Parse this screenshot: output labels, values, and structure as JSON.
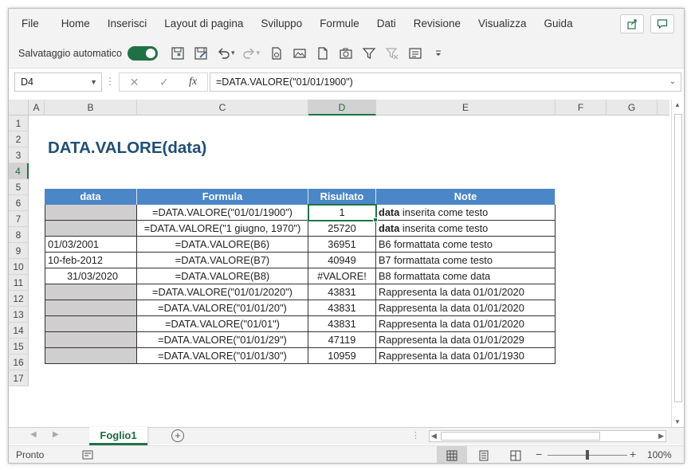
{
  "menu": [
    "File",
    "Home",
    "Inserisci",
    "Layout di pagina",
    "Sviluppo",
    "Formule",
    "Dati",
    "Revisione",
    "Visualizza",
    "Guida"
  ],
  "menu_right_icons": [
    "share-icon",
    "comment-icon"
  ],
  "toolbar": {
    "autosave_label": "Salvataggio automatico",
    "autosave_on": true,
    "icons": [
      "save-icon",
      "save-as-icon",
      "undo-icon",
      "redo-icon",
      "document-icon",
      "image-edit-icon",
      "new-document-icon",
      "camera-icon",
      "filter-icon",
      "clear-filter-icon",
      "form-icon",
      "customize-toolbar-icon"
    ]
  },
  "formula_bar": {
    "name_box": "D4",
    "formula": "=DATA.VALORE(\"01/01/1900\")"
  },
  "columns": [
    "A",
    "B",
    "C",
    "D",
    "E",
    "F",
    "G"
  ],
  "selected_column": "D",
  "rows": [
    "1",
    "2",
    "3",
    "4",
    "5",
    "6",
    "7",
    "8",
    "9",
    "10",
    "11",
    "12",
    "13",
    "14",
    "15",
    "16",
    "17"
  ],
  "selected_row": "4",
  "sheet_title": "DATA.VALORE(data)",
  "table": {
    "headers": [
      "data",
      "Formula",
      "Risultato",
      "Note"
    ],
    "rows": [
      {
        "data": "",
        "formula": "=DATA.VALORE(\"01/01/1900\")",
        "risultato": "1",
        "note_bold": "data",
        "note": " inserita come testo"
      },
      {
        "data": "",
        "formula": "=DATA.VALORE(\"1 giugno, 1970\")",
        "risultato": "25720",
        "note_bold": "data",
        "note": " inserita come testo"
      },
      {
        "data": "01/03/2001",
        "formula": "=DATA.VALORE(B6)",
        "risultato": "36951",
        "note_bold": "",
        "note": "B6 formattata come testo"
      },
      {
        "data": "10-feb-2012",
        "formula": "=DATA.VALORE(B7)",
        "risultato": "40949",
        "note_bold": "",
        "note": "B7 formattata come testo"
      },
      {
        "data": "31/03/2020",
        "formula": "=DATA.VALORE(B8)",
        "risultato": "#VALORE!",
        "note_bold": "",
        "note": "B8 formattata come data"
      },
      {
        "data": "",
        "formula": "=DATA.VALORE(\"01/01/2020\")",
        "risultato": "43831",
        "note_bold": "",
        "note": "Rappresenta la data 01/01/2020"
      },
      {
        "data": "",
        "formula": "=DATA.VALORE(\"01/01/20\")",
        "risultato": "43831",
        "note_bold": "",
        "note": "Rappresenta la data 01/01/2020"
      },
      {
        "data": "",
        "formula": "=DATA.VALORE(\"01/01\")",
        "risultato": "43831",
        "note_bold": "",
        "note": "Rappresenta la data 01/01/2020"
      },
      {
        "data": "",
        "formula": "=DATA.VALORE(\"01/01/29\")",
        "risultato": "47119",
        "note_bold": "",
        "note": "Rappresenta la data 01/01/2029"
      },
      {
        "data": "",
        "formula": "=DATA.VALORE(\"01/01/30\")",
        "risultato": "10959",
        "note_bold": "",
        "note": "Rappresenta la data 01/01/1930"
      }
    ]
  },
  "sheet_tabs": [
    "Foglio1"
  ],
  "status": {
    "ready": "Pronto",
    "zoom": "100%",
    "zoom_fraction": 0.5
  },
  "colors": {
    "accent": "#217346",
    "table_header": "#4a86c8",
    "title": "#1f4e78",
    "grey_cell": "#d0cece"
  }
}
